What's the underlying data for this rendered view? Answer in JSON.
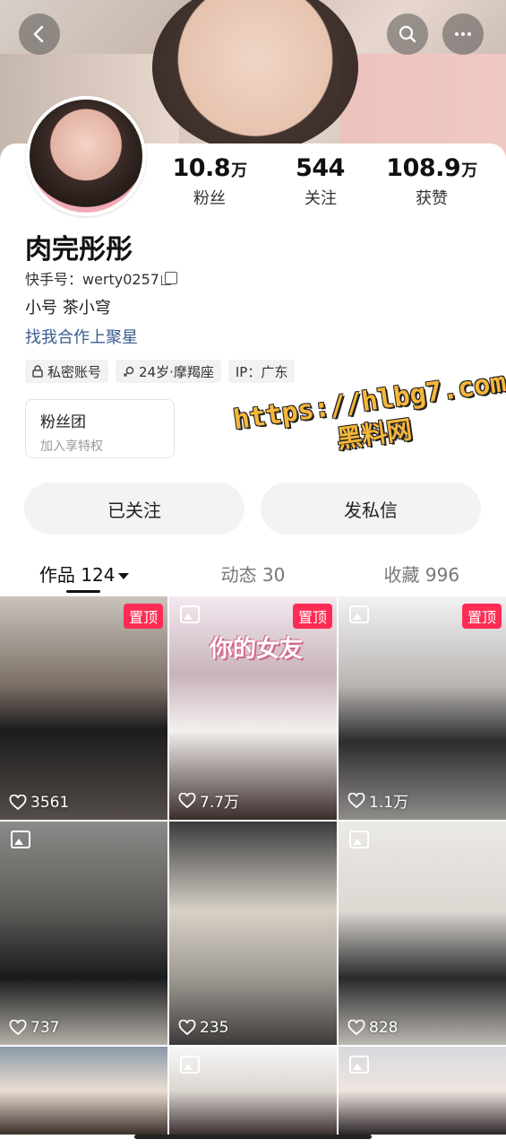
{
  "profile": {
    "name": "肉完彤彤",
    "kuaishou_id": "快手号：werty0257",
    "bio_line1": "小号 茶小穹",
    "bio_line2": "找我合作上聚星",
    "stats": [
      {
        "num": "10.8",
        "unit": "万",
        "label": "粉丝"
      },
      {
        "num": "544",
        "unit": "",
        "label": "关注"
      },
      {
        "num": "108.9",
        "unit": "万",
        "label": "获赞"
      }
    ],
    "tags": [
      "私密账号",
      "24岁·摩羯座",
      "IP：广东"
    ],
    "fans_club": {
      "title": "粉丝团",
      "subtitle": "加入享特权"
    }
  },
  "watermark": {
    "line1": "https://hlbg7.com",
    "line2": "黑料网"
  },
  "actions": {
    "followed": "已关注",
    "message": "发私信"
  },
  "tabs": [
    {
      "label": "作品 124",
      "active": true
    },
    {
      "label": "动态 30",
      "active": false
    },
    {
      "label": "收藏 996",
      "active": false
    }
  ],
  "grid": [
    {
      "likes": "3561",
      "pinned": "置顶",
      "image_post": false
    },
    {
      "likes": "7.7万",
      "pinned": "置顶",
      "image_post": true,
      "overlay": "你的女友"
    },
    {
      "likes": "1.1万",
      "pinned": "置顶",
      "image_post": true
    },
    {
      "likes": "737",
      "pinned": "",
      "image_post": true
    },
    {
      "likes": "235",
      "pinned": "",
      "image_post": false
    },
    {
      "likes": "828",
      "pinned": "",
      "image_post": true
    }
  ],
  "colors": {
    "pin": "#fe2c55",
    "link": "#3a5d8f",
    "watermark": "#f6b63a"
  },
  "icons": [
    "back-icon",
    "search-icon",
    "more-icon",
    "lock-icon",
    "gender-icon",
    "copy-icon",
    "heart-icon",
    "image-post-icon"
  ]
}
